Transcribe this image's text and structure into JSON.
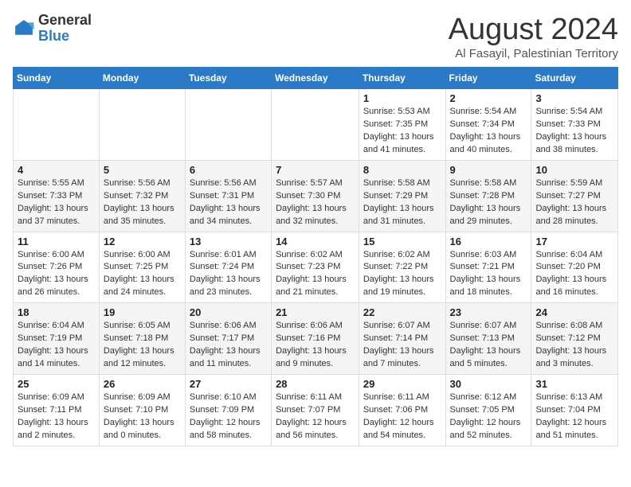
{
  "logo": {
    "general": "General",
    "blue": "Blue"
  },
  "header": {
    "month": "August 2024",
    "location": "Al Fasayil, Palestinian Territory"
  },
  "days_of_week": [
    "Sunday",
    "Monday",
    "Tuesday",
    "Wednesday",
    "Thursday",
    "Friday",
    "Saturday"
  ],
  "weeks": [
    [
      {
        "day": "",
        "info": ""
      },
      {
        "day": "",
        "info": ""
      },
      {
        "day": "",
        "info": ""
      },
      {
        "day": "",
        "info": ""
      },
      {
        "day": "1",
        "info": "Sunrise: 5:53 AM\nSunset: 7:35 PM\nDaylight: 13 hours and 41 minutes."
      },
      {
        "day": "2",
        "info": "Sunrise: 5:54 AM\nSunset: 7:34 PM\nDaylight: 13 hours and 40 minutes."
      },
      {
        "day": "3",
        "info": "Sunrise: 5:54 AM\nSunset: 7:33 PM\nDaylight: 13 hours and 38 minutes."
      }
    ],
    [
      {
        "day": "4",
        "info": "Sunrise: 5:55 AM\nSunset: 7:33 PM\nDaylight: 13 hours and 37 minutes."
      },
      {
        "day": "5",
        "info": "Sunrise: 5:56 AM\nSunset: 7:32 PM\nDaylight: 13 hours and 35 minutes."
      },
      {
        "day": "6",
        "info": "Sunrise: 5:56 AM\nSunset: 7:31 PM\nDaylight: 13 hours and 34 minutes."
      },
      {
        "day": "7",
        "info": "Sunrise: 5:57 AM\nSunset: 7:30 PM\nDaylight: 13 hours and 32 minutes."
      },
      {
        "day": "8",
        "info": "Sunrise: 5:58 AM\nSunset: 7:29 PM\nDaylight: 13 hours and 31 minutes."
      },
      {
        "day": "9",
        "info": "Sunrise: 5:58 AM\nSunset: 7:28 PM\nDaylight: 13 hours and 29 minutes."
      },
      {
        "day": "10",
        "info": "Sunrise: 5:59 AM\nSunset: 7:27 PM\nDaylight: 13 hours and 28 minutes."
      }
    ],
    [
      {
        "day": "11",
        "info": "Sunrise: 6:00 AM\nSunset: 7:26 PM\nDaylight: 13 hours and 26 minutes."
      },
      {
        "day": "12",
        "info": "Sunrise: 6:00 AM\nSunset: 7:25 PM\nDaylight: 13 hours and 24 minutes."
      },
      {
        "day": "13",
        "info": "Sunrise: 6:01 AM\nSunset: 7:24 PM\nDaylight: 13 hours and 23 minutes."
      },
      {
        "day": "14",
        "info": "Sunrise: 6:02 AM\nSunset: 7:23 PM\nDaylight: 13 hours and 21 minutes."
      },
      {
        "day": "15",
        "info": "Sunrise: 6:02 AM\nSunset: 7:22 PM\nDaylight: 13 hours and 19 minutes."
      },
      {
        "day": "16",
        "info": "Sunrise: 6:03 AM\nSunset: 7:21 PM\nDaylight: 13 hours and 18 minutes."
      },
      {
        "day": "17",
        "info": "Sunrise: 6:04 AM\nSunset: 7:20 PM\nDaylight: 13 hours and 16 minutes."
      }
    ],
    [
      {
        "day": "18",
        "info": "Sunrise: 6:04 AM\nSunset: 7:19 PM\nDaylight: 13 hours and 14 minutes."
      },
      {
        "day": "19",
        "info": "Sunrise: 6:05 AM\nSunset: 7:18 PM\nDaylight: 13 hours and 12 minutes."
      },
      {
        "day": "20",
        "info": "Sunrise: 6:06 AM\nSunset: 7:17 PM\nDaylight: 13 hours and 11 minutes."
      },
      {
        "day": "21",
        "info": "Sunrise: 6:06 AM\nSunset: 7:16 PM\nDaylight: 13 hours and 9 minutes."
      },
      {
        "day": "22",
        "info": "Sunrise: 6:07 AM\nSunset: 7:14 PM\nDaylight: 13 hours and 7 minutes."
      },
      {
        "day": "23",
        "info": "Sunrise: 6:07 AM\nSunset: 7:13 PM\nDaylight: 13 hours and 5 minutes."
      },
      {
        "day": "24",
        "info": "Sunrise: 6:08 AM\nSunset: 7:12 PM\nDaylight: 13 hours and 3 minutes."
      }
    ],
    [
      {
        "day": "25",
        "info": "Sunrise: 6:09 AM\nSunset: 7:11 PM\nDaylight: 13 hours and 2 minutes."
      },
      {
        "day": "26",
        "info": "Sunrise: 6:09 AM\nSunset: 7:10 PM\nDaylight: 13 hours and 0 minutes."
      },
      {
        "day": "27",
        "info": "Sunrise: 6:10 AM\nSunset: 7:09 PM\nDaylight: 12 hours and 58 minutes."
      },
      {
        "day": "28",
        "info": "Sunrise: 6:11 AM\nSunset: 7:07 PM\nDaylight: 12 hours and 56 minutes."
      },
      {
        "day": "29",
        "info": "Sunrise: 6:11 AM\nSunset: 7:06 PM\nDaylight: 12 hours and 54 minutes."
      },
      {
        "day": "30",
        "info": "Sunrise: 6:12 AM\nSunset: 7:05 PM\nDaylight: 12 hours and 52 minutes."
      },
      {
        "day": "31",
        "info": "Sunrise: 6:13 AM\nSunset: 7:04 PM\nDaylight: 12 hours and 51 minutes."
      }
    ]
  ]
}
